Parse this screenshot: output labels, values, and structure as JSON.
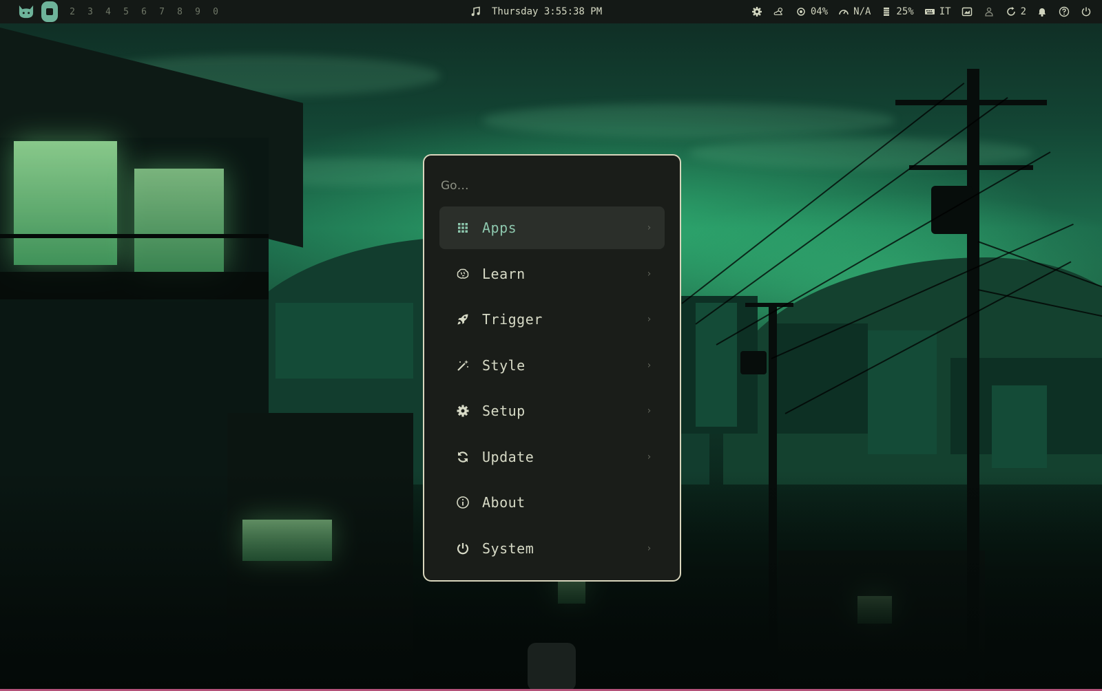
{
  "topbar": {
    "workspaces": [
      "2",
      "3",
      "4",
      "5",
      "6",
      "7",
      "8",
      "9",
      "0"
    ],
    "clock": "Thursday 3:55:38 PM",
    "status": {
      "cpu": "04%",
      "network": "N/A",
      "memory": "25%",
      "keyboard_layout": "IT",
      "updates": "2"
    }
  },
  "launcher": {
    "search_placeholder": "Go…",
    "items": [
      {
        "label": "Apps",
        "icon": "grid-icon",
        "selected": true
      },
      {
        "label": "Learn",
        "icon": "brain-icon",
        "selected": false
      },
      {
        "label": "Trigger",
        "icon": "rocket-icon",
        "selected": false
      },
      {
        "label": "Style",
        "icon": "magic-wand-icon",
        "selected": false
      },
      {
        "label": "Setup",
        "icon": "gear-icon",
        "selected": false
      },
      {
        "label": "Update",
        "icon": "refresh-icon",
        "selected": false
      },
      {
        "label": "About",
        "icon": "info-icon",
        "selected": false
      },
      {
        "label": "System",
        "icon": "power-icon",
        "selected": false
      }
    ],
    "chevron": "›"
  },
  "colors": {
    "accent": "#6eb39a",
    "launcher_border": "#d9d6bd",
    "launcher_bg": "#1a1d19",
    "selected_bg": "#2b2f2a",
    "topbar_bg": "#141916"
  }
}
